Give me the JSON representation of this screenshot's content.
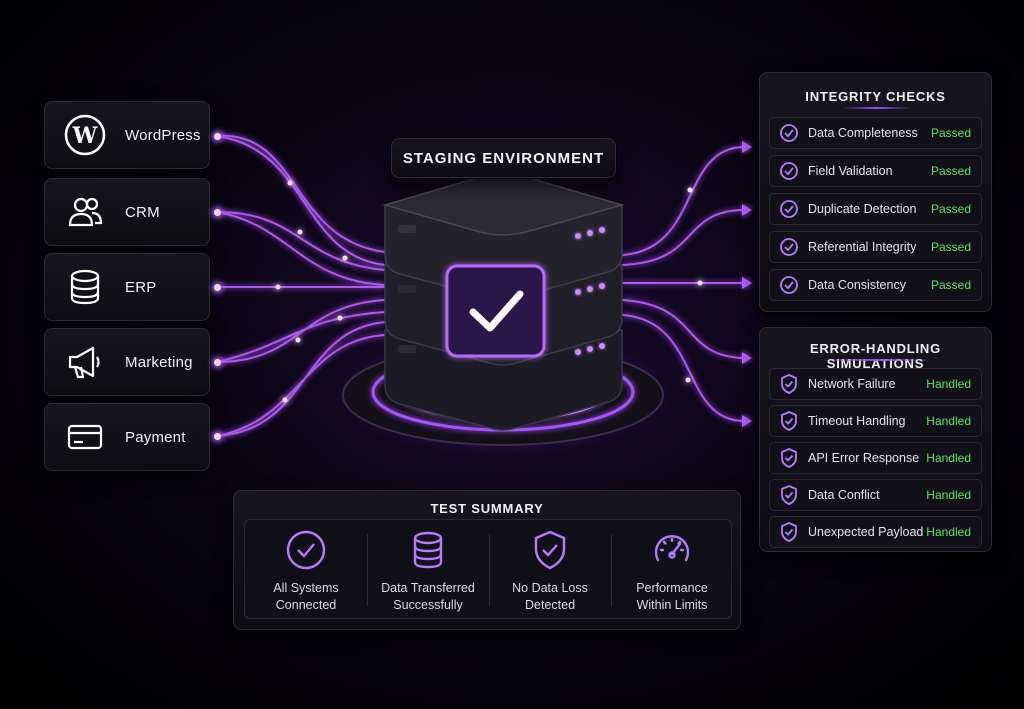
{
  "sources": [
    {
      "label": "WordPress",
      "icon": "wordpress-icon"
    },
    {
      "label": "CRM",
      "icon": "users-icon"
    },
    {
      "label": "ERP",
      "icon": "database-icon"
    },
    {
      "label": "Marketing",
      "icon": "megaphone-icon"
    },
    {
      "label": "Payment",
      "icon": "credit-card-icon"
    }
  ],
  "staging": {
    "title": "STAGING ENVIRONMENT"
  },
  "integrity": {
    "title": "INTEGRITY CHECKS",
    "items": [
      {
        "label": "Data Completeness",
        "status": "Passed"
      },
      {
        "label": "Field Validation",
        "status": "Passed"
      },
      {
        "label": "Duplicate Detection",
        "status": "Passed"
      },
      {
        "label": "Referential Integrity",
        "status": "Passed"
      },
      {
        "label": "Data Consistency",
        "status": "Passed"
      }
    ]
  },
  "errors": {
    "title": "ERROR-HANDLING SIMULATIONS",
    "items": [
      {
        "label": "Network Failure",
        "status": "Handled"
      },
      {
        "label": "Timeout Handling",
        "status": "Handled"
      },
      {
        "label": "API Error Response",
        "status": "Handled"
      },
      {
        "label": "Data Conflict",
        "status": "Handled"
      },
      {
        "label": "Unexpected Payload",
        "status": "Handled"
      }
    ]
  },
  "summary": {
    "title": "TEST SUMMARY",
    "items": [
      {
        "line1": "All Systems",
        "line2": "Connected",
        "icon": "check-circle-icon"
      },
      {
        "line1": "Data Transferred",
        "line2": "Successfully",
        "icon": "database-icon"
      },
      {
        "line1": "No Data Loss",
        "line2": "Detected",
        "icon": "shield-check-icon"
      },
      {
        "line1": "Performance",
        "line2": "Within Limits",
        "icon": "gauge-icon"
      }
    ]
  },
  "colors": {
    "accent": "#9b4dff",
    "glow": "#c77dff",
    "success": "#5ee26a"
  }
}
